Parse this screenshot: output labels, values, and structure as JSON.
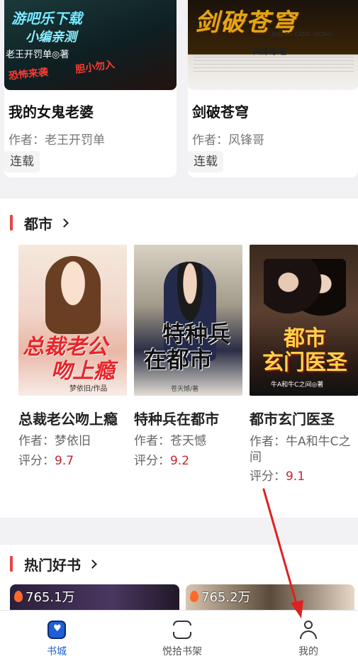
{
  "top_books": [
    {
      "title": "我的女鬼老婆",
      "author": "作者：老王开罚单",
      "status": "连载",
      "cover_text": [
        "游吧乐下载",
        "小编亲测",
        "老王开罚单◎著",
        "恐怖来袭",
        "胆小勿入"
      ]
    },
    {
      "title": "剑破苍穹",
      "author": "作者：风锋哥",
      "status": "连载",
      "cover_text": [
        "剑破苍穹",
        "JIAN PO CANG QIONG",
        "风锋哥/著"
      ]
    }
  ],
  "sections": {
    "city": {
      "title": "都市",
      "books": [
        {
          "title": "总裁老公吻上瘾",
          "author_label": "作者：",
          "author": "梦依旧",
          "score_label": "评分：",
          "score": "9.7",
          "cover_text": [
            "总裁老公",
            "吻上瘾",
            "梦依旧/作品"
          ]
        },
        {
          "title": "特种兵在都市",
          "author_label": "作者：",
          "author": "苍天憾",
          "score_label": "评分：",
          "score": "9.2",
          "cover_text": [
            "特种兵",
            "在都市",
            "苍天憾/著"
          ]
        },
        {
          "title": "都市玄门医圣",
          "author_label": "作者：",
          "author": "牛A和牛C之间",
          "score_label": "评分：",
          "score": "9.1",
          "cover_text": [
            "都市",
            "玄门医圣",
            "牛A和牛C之间◎著"
          ]
        }
      ]
    },
    "hot": {
      "title": "热门好书",
      "cards": [
        {
          "count": "765.1万"
        },
        {
          "count": "765.2万"
        }
      ]
    }
  },
  "bottom_nav": [
    {
      "label": "书城",
      "icon": "bookstore-icon",
      "active": true
    },
    {
      "label": "悦拾书架",
      "icon": "bookshelf-icon",
      "active": false
    },
    {
      "label": "我的",
      "icon": "person-icon",
      "active": false
    }
  ],
  "colors": {
    "accent": "#1f5fd6",
    "section_bar": "#e64545",
    "score": "#c9252c",
    "arrow": "#e02020"
  }
}
